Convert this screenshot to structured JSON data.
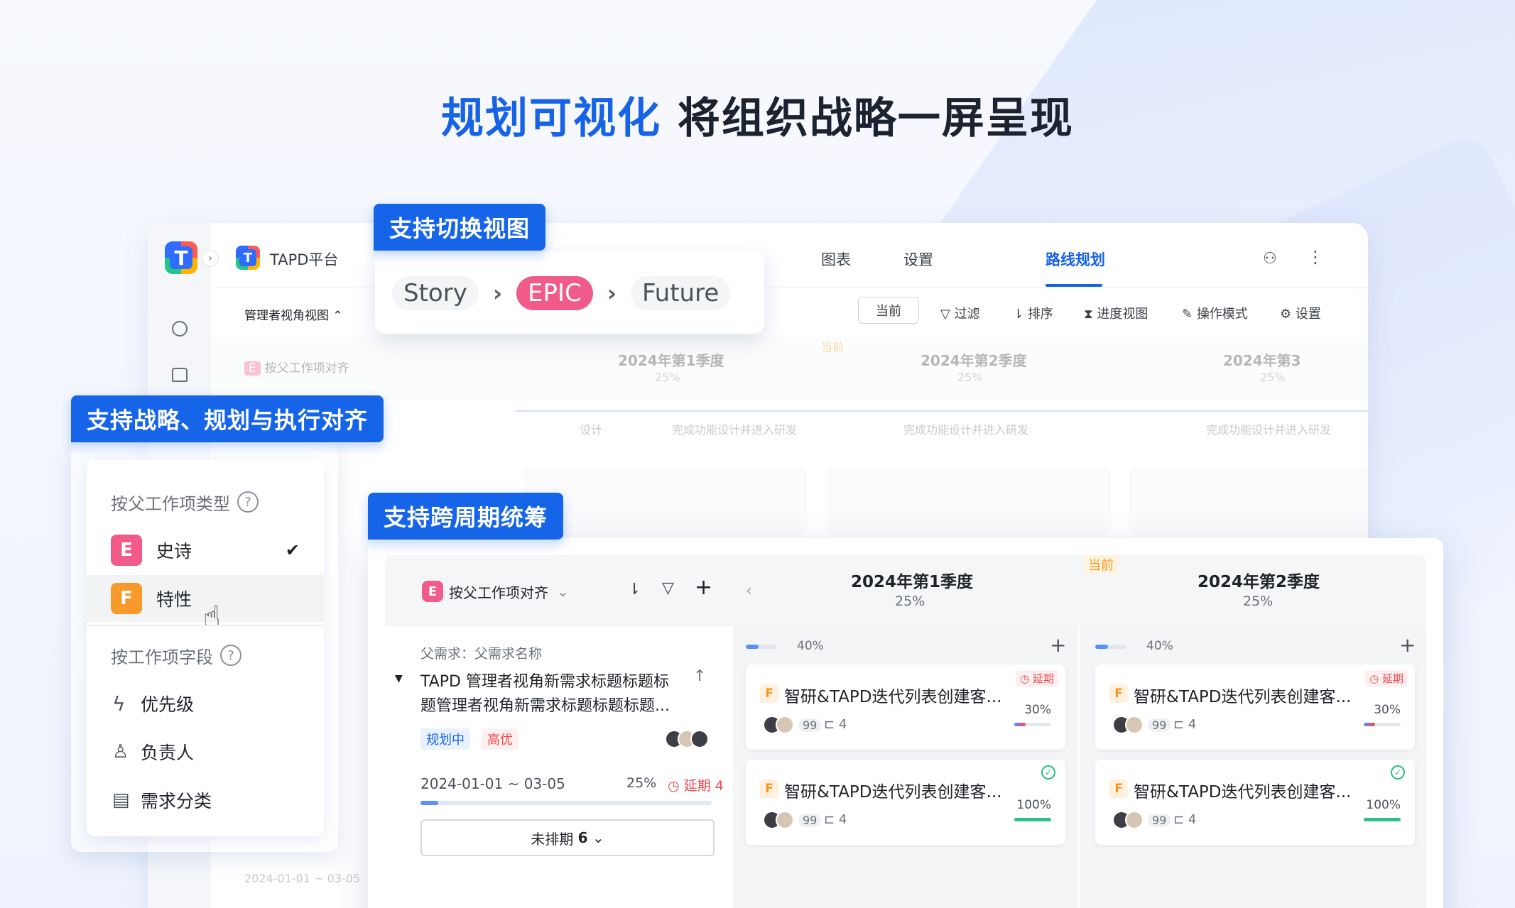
{
  "headline": {
    "highlight": "规划可视化",
    "rest": " 将组织战略一屏呈现"
  },
  "callouts": {
    "switch_view": "支持切换视图",
    "align": "支持战略、规划与执行对齐",
    "cross_period": "支持跨周期统筹"
  },
  "breadcrumb": {
    "items": [
      "Story",
      "EPIC",
      "Future"
    ]
  },
  "app": {
    "name": "TAPD平台",
    "nav": [
      "图表",
      "设置",
      "路线规划"
    ],
    "view_selector": "管理者视角视图",
    "toolbar": {
      "current": "当前",
      "filter": "过滤",
      "sort": "排序",
      "progress": "进度视图",
      "mode": "操作模式",
      "settings": "设置"
    },
    "align_label": "按父工作项对齐",
    "quarters": [
      {
        "title": "2024年第1季度",
        "pct": "25%"
      },
      {
        "title": "2024年第2季度",
        "pct": "25%"
      },
      {
        "title": "2024年第3",
        "pct": "25%"
      }
    ],
    "current_tag": "当前",
    "milestones": [
      "设计",
      "完成功能设计并进入研发",
      "完成功能设计并进入研发",
      "完成功能设计并进入研发"
    ],
    "date": "2024-01-01 ~ 03-05"
  },
  "dropdown": {
    "section1": "按父工作项类型",
    "item_epic": {
      "tag": "E",
      "label": "史诗"
    },
    "item_feature": {
      "tag": "F",
      "label": "特性"
    },
    "section2": "按工作项字段",
    "fields": [
      "优先级",
      "负责人",
      "需求分类"
    ]
  },
  "front": {
    "align_label": "按父工作项对齐",
    "quarters": [
      {
        "title": "2024年第1季度",
        "pct": "25%",
        "col_pct": "40%"
      },
      {
        "title": "2024年第2季度",
        "pct": "25%",
        "col_pct": "40%"
      }
    ],
    "current_tag": "当前",
    "parent": {
      "label": "父需求：父需求名称",
      "title_line1": "TAPD 管理者视角新需求标题标题标",
      "title_line2": "题管理者视角新需求标题标题标题...",
      "tags": [
        "规划中",
        "高优"
      ],
      "date": "2024-01-01  ~  03-05",
      "pct": "25%",
      "delay": "延期 4",
      "progress": 0.06
    },
    "unscheduled": {
      "label": "未排期",
      "count": "6"
    },
    "cards": [
      {
        "tag": "F",
        "title": "智研&TAPD迭代列表创建客...",
        "count": "99",
        "sub": "4",
        "pct": "30%",
        "status": "延期",
        "progress": 0.3
      },
      {
        "tag": "F",
        "title": "智研&TAPD迭代列表创建客...",
        "count": "99",
        "sub": "4",
        "pct": "100%",
        "status": "done",
        "progress": 1.0
      },
      {
        "tag": "F",
        "title": "智研&TAPD迭代列表创建客...",
        "count": "99",
        "sub": "4",
        "pct": "30%",
        "status": "延期",
        "progress": 0.3
      },
      {
        "tag": "F",
        "title": "智研&TAPD迭代列表创建客...",
        "count": "99",
        "sub": "4",
        "pct": "100%",
        "status": "done",
        "progress": 1.0
      }
    ]
  },
  "colors": {
    "accent": "#1665e8",
    "epic": "#f05b8a",
    "feature": "#f79a2a",
    "late": "#f0484e",
    "done": "#2cc085"
  }
}
